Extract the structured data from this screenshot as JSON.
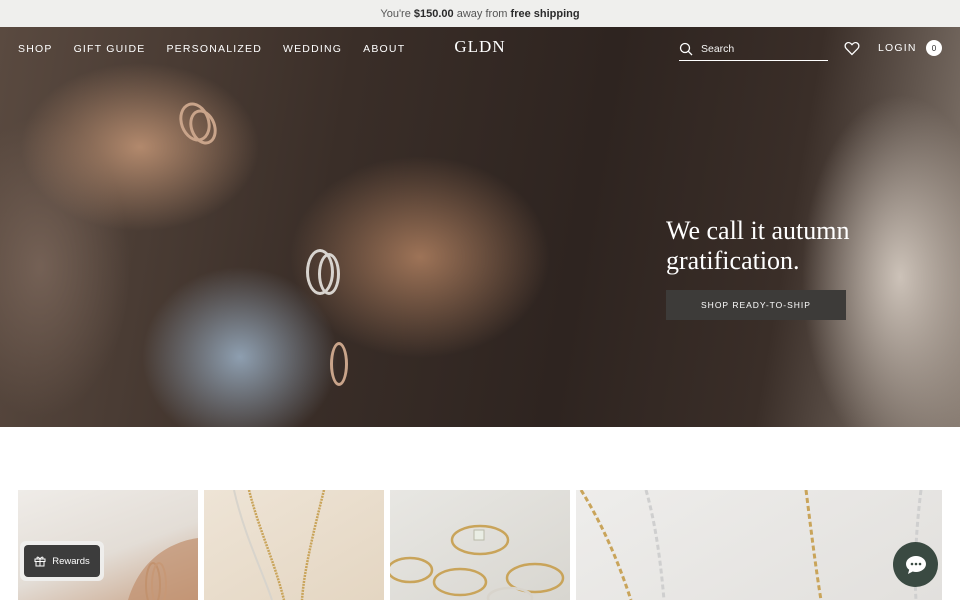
{
  "announcement": {
    "prefix": "You're",
    "amount": "$150.00",
    "middle": "away from",
    "highlight": "free shipping"
  },
  "nav": {
    "links": [
      "SHOP",
      "GIFT GUIDE",
      "PERSONALIZED",
      "WEDDING",
      "ABOUT"
    ],
    "logo": "GLDN",
    "search_placeholder": "Search",
    "login": "LOGIN",
    "cart_count": "0"
  },
  "hero": {
    "title_line1": "We call it autumn",
    "title_line2": "gratification.",
    "cta": "SHOP READY-TO-SHIP"
  },
  "widgets": {
    "rewards_label": "Rewards"
  },
  "icons": [
    "search-icon",
    "heart-icon",
    "cart-icon",
    "gift-icon",
    "chat-icon"
  ],
  "colors": {
    "cta_bg": "#3d3b39",
    "announce_bg": "#efefed",
    "chat_bg": "#3a4a42"
  }
}
